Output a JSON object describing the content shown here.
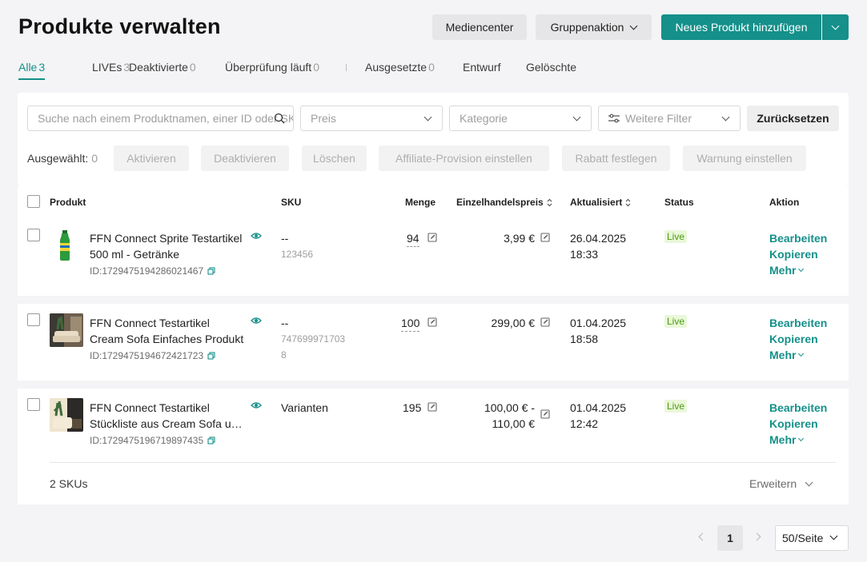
{
  "header": {
    "title": "Produkte verwalten",
    "media_center": "Mediencenter",
    "bulk_action": "Gruppenaktion",
    "add_product": "Neues Produkt hinzufügen"
  },
  "tabs": [
    {
      "label": "Alle",
      "count": "3"
    },
    {
      "label": "LIVEs",
      "count": "3"
    },
    {
      "label": "Deaktivierte",
      "count": "0"
    },
    {
      "label": "Überprüfung läuft",
      "count": "0"
    },
    {
      "label": "Ausgesetzte",
      "count": "0"
    },
    {
      "label": "Entwurf",
      "count": ""
    },
    {
      "label": "Gelöschte",
      "count": ""
    }
  ],
  "filters": {
    "search_placeholder": "Suche nach einem Produktnamen, einer ID oder SKU",
    "price": "Preis",
    "category": "Kategorie",
    "more_filters": "Weitere Filter",
    "reset": "Zurücksetzen"
  },
  "bulk": {
    "selected_label": "Ausgewählt:",
    "selected_count": "0",
    "activate": "Aktivieren",
    "deactivate": "Deaktivieren",
    "delete": "Löschen",
    "affiliate": "Affiliate-Provision einstellen",
    "discount": "Rabatt festlegen",
    "warning": "Warnung einstellen"
  },
  "columns": {
    "product": "Produkt",
    "sku": "SKU",
    "quantity": "Menge",
    "retail_price": "Einzelhandelspreis",
    "updated": "Aktualisiert",
    "status": "Status",
    "action": "Aktion"
  },
  "products": [
    {
      "name_line1": "FFN Connect Sprite Testartikel",
      "name_line2": "500 ml - Getränke",
      "id": "ID:1729475194286021467",
      "sku": "--",
      "sku_sub1": "123456",
      "sku_sub2": "",
      "quantity": "94",
      "price_line1": "3,99 €",
      "price_line2": "",
      "updated_date": "26.04.2025",
      "updated_time": "18:33",
      "status": "Live"
    },
    {
      "name_line1": "FFN Connect Testartikel",
      "name_line2": "Cream Sofa Einfaches Produkt",
      "id": "ID:1729475194672421723",
      "sku": "--",
      "sku_sub1": "747699971703",
      "sku_sub2": "8",
      "quantity": "100",
      "price_line1": "299,00 €",
      "price_line2": "",
      "updated_date": "01.04.2025",
      "updated_time": "18:58",
      "status": "Live"
    },
    {
      "name_line1": "FFN Connect Testartikel",
      "name_line2": "Stückliste aus Cream Sofa u…",
      "id": "ID:1729475196719897435",
      "sku": "Varianten",
      "sku_sub1": "",
      "sku_sub2": "",
      "quantity": "195",
      "price_line1": "100,00 € -",
      "price_line2": "110,00 €",
      "updated_date": "01.04.2025",
      "updated_time": "12:42",
      "status": "Live",
      "sku_count": "2 SKUs",
      "expand": "Erweitern"
    }
  ],
  "row_actions": {
    "edit": "Bearbeiten",
    "copy": "Kopieren",
    "more": "Mehr"
  },
  "pagination": {
    "current_page": "1",
    "page_size": "50/Seite"
  },
  "colors": {
    "accent": "#15908a",
    "live_bg": "#eaf7d9",
    "live_text": "#4a9b10"
  }
}
